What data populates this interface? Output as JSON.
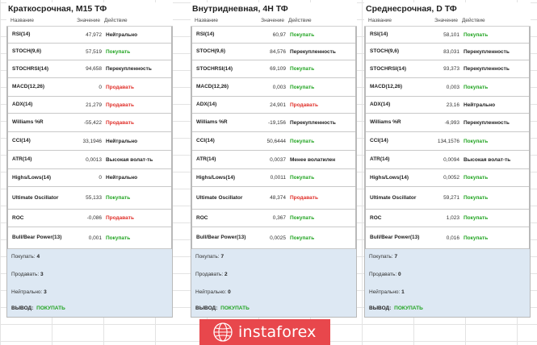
{
  "columns": {
    "name": "Название",
    "value": "Значение",
    "action": "Действие"
  },
  "summary_labels": {
    "buy": "Покупать:",
    "sell": "Продавать:",
    "neutral": "Нейтрально:",
    "verdict": "ВЫВОД:"
  },
  "panels": [
    {
      "title": "Краткосрочная, M15 ТФ",
      "rows": [
        {
          "name": "RSI(14)",
          "value": "47,972",
          "action": "Нейтрально",
          "signal": "neutral"
        },
        {
          "name": "STOCH(9,6)",
          "value": "57,519",
          "action": "Покупать",
          "signal": "buy"
        },
        {
          "name": "STOCHRSI(14)",
          "value": "94,658",
          "action": "Перекупленность",
          "signal": "neutral"
        },
        {
          "name": "MACD(12,26)",
          "value": "0",
          "action": "Продавать",
          "signal": "sell"
        },
        {
          "name": "ADX(14)",
          "value": "21,279",
          "action": "Продавать",
          "signal": "sell"
        },
        {
          "name": "Williams %R",
          "value": "-55,422",
          "action": "Продавать",
          "signal": "sell"
        },
        {
          "name": "CCI(14)",
          "value": "33,1946",
          "action": "Нейтрально",
          "signal": "neutral"
        },
        {
          "name": "ATR(14)",
          "value": "0,0013",
          "action": "Высокая волат-ть",
          "signal": "neutral"
        },
        {
          "name": "Highs/Lows(14)",
          "value": "0",
          "action": "Нейтрально",
          "signal": "neutral"
        },
        {
          "name": "Ultimate Oscillator",
          "value": "55,133",
          "action": "Покупать",
          "signal": "buy"
        },
        {
          "name": "ROC",
          "value": "-0,086",
          "action": "Продавать",
          "signal": "sell"
        },
        {
          "name": "Bull/Bear Power(13)",
          "value": "0,001",
          "action": "Покупать",
          "signal": "buy"
        }
      ],
      "summary": {
        "buy": "4",
        "sell": "3",
        "neutral": "3",
        "verdict": "ПОКУПАТЬ"
      }
    },
    {
      "title": "Внутридневная, 4H ТФ",
      "rows": [
        {
          "name": "RSI(14)",
          "value": "60,97",
          "action": "Покупать",
          "signal": "buy"
        },
        {
          "name": "STOCH(9,6)",
          "value": "84,576",
          "action": "Перекупленность",
          "signal": "neutral"
        },
        {
          "name": "STOCHRSI(14)",
          "value": "69,109",
          "action": "Покупать",
          "signal": "buy"
        },
        {
          "name": "MACD(12,26)",
          "value": "0,003",
          "action": "Покупать",
          "signal": "buy"
        },
        {
          "name": "ADX(14)",
          "value": "24,901",
          "action": "Продавать",
          "signal": "sell"
        },
        {
          "name": "Williams %R",
          "value": "-19,156",
          "action": "Перекупленность",
          "signal": "neutral"
        },
        {
          "name": "CCI(14)",
          "value": "50,6444",
          "action": "Покупать",
          "signal": "buy"
        },
        {
          "name": "ATR(14)",
          "value": "0,0037",
          "action": "Менее волатилен",
          "signal": "neutral"
        },
        {
          "name": "Highs/Lows(14)",
          "value": "0,0011",
          "action": "Покупать",
          "signal": "buy"
        },
        {
          "name": "Ultimate Oscillator",
          "value": "48,374",
          "action": "Продавать",
          "signal": "sell"
        },
        {
          "name": "ROC",
          "value": "0,367",
          "action": "Покупать",
          "signal": "buy"
        },
        {
          "name": "Bull/Bear Power(13)",
          "value": "0,0025",
          "action": "Покупать",
          "signal": "buy"
        }
      ],
      "summary": {
        "buy": "7",
        "sell": "2",
        "neutral": "0",
        "verdict": "ПОКУПАТЬ"
      }
    },
    {
      "title": "Среднесрочная, D ТФ",
      "rows": [
        {
          "name": "RSI(14)",
          "value": "58,101",
          "action": "Покупать",
          "signal": "buy"
        },
        {
          "name": "STOCH(9,6)",
          "value": "83,031",
          "action": "Перекупленность",
          "signal": "neutral"
        },
        {
          "name": "STOCHRSI(14)",
          "value": "93,373",
          "action": "Перекупленность",
          "signal": "neutral"
        },
        {
          "name": "MACD(12,26)",
          "value": "0,003",
          "action": "Покупать",
          "signal": "buy"
        },
        {
          "name": "ADX(14)",
          "value": "23,16",
          "action": "Нейтрально",
          "signal": "neutral"
        },
        {
          "name": "Williams %R",
          "value": "-6,993",
          "action": "Перекупленность",
          "signal": "neutral"
        },
        {
          "name": "CCI(14)",
          "value": "134,1576",
          "action": "Покупать",
          "signal": "buy"
        },
        {
          "name": "ATR(14)",
          "value": "0,0094",
          "action": "Высокая волат-ть",
          "signal": "neutral"
        },
        {
          "name": "Highs/Lows(14)",
          "value": "0,0052",
          "action": "Покупать",
          "signal": "buy"
        },
        {
          "name": "Ultimate Oscillator",
          "value": "59,271",
          "action": "Покупать",
          "signal": "buy"
        },
        {
          "name": "ROC",
          "value": "1,023",
          "action": "Покупать",
          "signal": "buy"
        },
        {
          "name": "Bull/Bear Power(13)",
          "value": "0,016",
          "action": "Покупать",
          "signal": "buy"
        }
      ],
      "summary": {
        "buy": "7",
        "sell": "0",
        "neutral": "1",
        "verdict": "ПОКУПАТЬ"
      }
    }
  ],
  "logo": {
    "text": "instaforex",
    "icon": "instaforex-logo-icon",
    "color": "#e8474c"
  },
  "colors": {
    "buy": "#21a421",
    "sell": "#e0302a",
    "summary_bg": "#dde8f3"
  }
}
